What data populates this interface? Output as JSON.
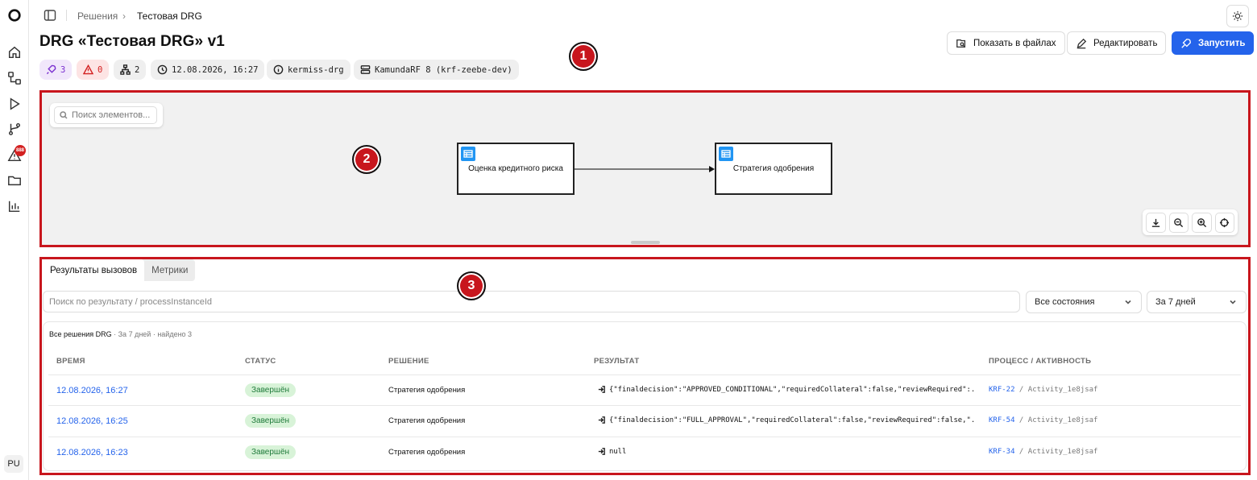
{
  "sidebar": {
    "logo": "logo-icon",
    "items": [
      {
        "icon": "home-icon"
      },
      {
        "icon": "flow-icon"
      },
      {
        "icon": "play-icon"
      },
      {
        "icon": "branch-icon"
      },
      {
        "icon": "alert-icon",
        "badge": "888"
      },
      {
        "icon": "folder-icon"
      },
      {
        "icon": "chart-icon"
      }
    ],
    "avatar": "PU"
  },
  "breadcrumb": {
    "parent": "Решения",
    "separator": "›",
    "current": "Тестовая DRG"
  },
  "header": {
    "title": "DRG «Тестовая DRG» v1",
    "buttons": {
      "show_files": "Показать в файлах",
      "edit": "Редактировать",
      "run": "Запустить"
    },
    "chips": {
      "runs": "3",
      "errors": "0",
      "nodes": "2",
      "date": "12.08.2026, 16:27",
      "owner": "kermiss-drg",
      "engine": "KamundaRF 8 (krf-zeebe-dev)"
    }
  },
  "markers": {
    "one": "1",
    "two": "2",
    "three": "3"
  },
  "canvas": {
    "search_placeholder": "Поиск элементов...",
    "nodes": [
      {
        "label": "Оценка кредитного риска"
      },
      {
        "label": "Стратегия одобрения"
      }
    ]
  },
  "results": {
    "tabs": [
      "Результаты вызовов",
      "Метрики"
    ],
    "search_placeholder": "Поиск по результату / processInstanceId",
    "state_filter": "Все состояния",
    "period_filter": "За 7 дней",
    "caption": {
      "main": "Все решения DRG",
      "meta": " · За 7 дней · найдено 3"
    },
    "columns": [
      "ВРЕМЯ",
      "СТАТУС",
      "РЕШЕНИЕ",
      "РЕЗУЛЬТАТ",
      "ПРОЦЕСС / АКТИВНОСТЬ"
    ],
    "rows": [
      {
        "time": "12.08.2026, 16:27",
        "status": "Завершён",
        "decision": "Стратегия одобрения",
        "result": "{\"finaldecision\":\"APPROVED_CONDITIONAL\",\"requiredCollateral\":false,\"reviewRequired\":...",
        "process_key": "KRF-22",
        "activity": " / Activity_1e8jsaf"
      },
      {
        "time": "12.08.2026, 16:25",
        "status": "Завершён",
        "decision": "Стратегия одобрения",
        "result": "{\"finaldecision\":\"FULL_APPROVAL\",\"requiredCollateral\":false,\"reviewRequired\":false,\"...",
        "process_key": "KRF-54",
        "activity": " / Activity_1e8jsaf"
      },
      {
        "time": "12.08.2026, 16:23",
        "status": "Завершён",
        "decision": "Стратегия одобрения",
        "result": "null",
        "process_key": "KRF-34",
        "activity": " / Activity_1e8jsaf"
      }
    ]
  },
  "colors": {
    "accent": "#2463eb",
    "marker": "#c8161d",
    "success_bg": "#d8f3d8",
    "success_text": "#1f7a3a",
    "node_icon": "#2195f3"
  }
}
